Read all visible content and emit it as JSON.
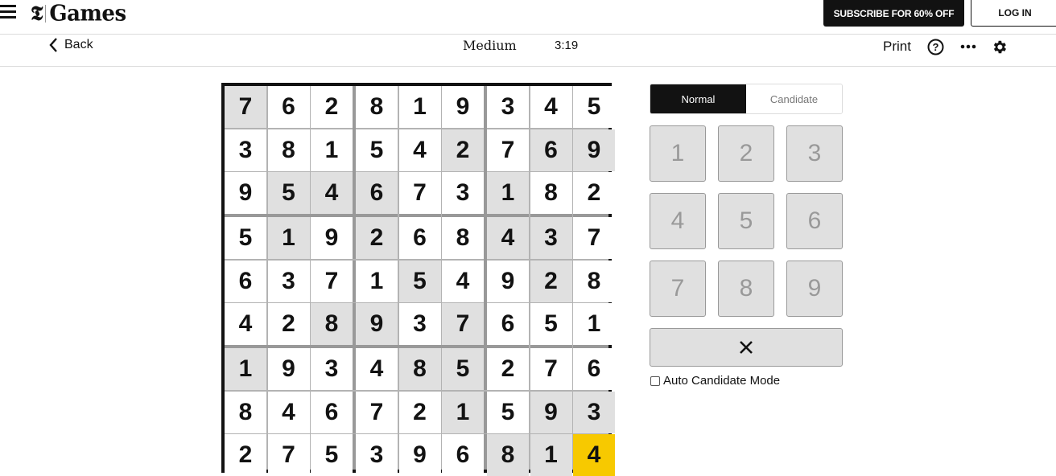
{
  "header": {
    "logo_mark": "𝕿",
    "logo_text": "Games",
    "subscribe_label": "SUBSCRIBE FOR 60% OFF",
    "login_label": "LOG IN"
  },
  "toolbar": {
    "back_label": "Back",
    "difficulty": "Medium",
    "timer": "3:19",
    "print_label": "Print",
    "icons": [
      "help-icon",
      "more-icon",
      "settings-icon"
    ]
  },
  "board": {
    "rows": [
      [
        7,
        6,
        2,
        8,
        1,
        9,
        3,
        4,
        5
      ],
      [
        3,
        8,
        1,
        5,
        4,
        2,
        7,
        6,
        9
      ],
      [
        9,
        5,
        4,
        6,
        7,
        3,
        1,
        8,
        2
      ],
      [
        5,
        1,
        9,
        2,
        6,
        8,
        4,
        3,
        7
      ],
      [
        6,
        3,
        7,
        1,
        5,
        4,
        9,
        2,
        8
      ],
      [
        4,
        2,
        8,
        9,
        3,
        7,
        6,
        5,
        1
      ],
      [
        1,
        9,
        3,
        4,
        8,
        5,
        2,
        7,
        6
      ],
      [
        8,
        4,
        6,
        7,
        2,
        1,
        5,
        9,
        3
      ],
      [
        2,
        7,
        5,
        3,
        9,
        6,
        8,
        1,
        4
      ]
    ],
    "given": [
      [
        1,
        0,
        0,
        0,
        0,
        0,
        0,
        0,
        0
      ],
      [
        0,
        0,
        0,
        0,
        0,
        1,
        0,
        1,
        1
      ],
      [
        0,
        1,
        1,
        1,
        0,
        0,
        1,
        0,
        0
      ],
      [
        0,
        1,
        0,
        1,
        0,
        0,
        1,
        1,
        0
      ],
      [
        0,
        0,
        0,
        0,
        1,
        0,
        0,
        1,
        0
      ],
      [
        0,
        0,
        1,
        1,
        0,
        1,
        0,
        0,
        0
      ],
      [
        1,
        0,
        0,
        0,
        1,
        1,
        0,
        0,
        0
      ],
      [
        0,
        0,
        0,
        0,
        0,
        1,
        0,
        1,
        1
      ],
      [
        0,
        0,
        0,
        0,
        0,
        0,
        1,
        1,
        0
      ]
    ],
    "selected": [
      8,
      8
    ],
    "colors": {
      "given": "#e0e0e0",
      "selected": "#f7c900",
      "empty": "#ffffff"
    }
  },
  "controls": {
    "modes": [
      {
        "label": "Normal",
        "active": true
      },
      {
        "label": "Candidate",
        "active": false
      }
    ],
    "numpad": [
      "1",
      "2",
      "3",
      "4",
      "5",
      "6",
      "7",
      "8",
      "9"
    ],
    "erase_icon": "close-icon",
    "auto_candidate_label": "Auto Candidate Mode",
    "auto_candidate_checked": false
  }
}
